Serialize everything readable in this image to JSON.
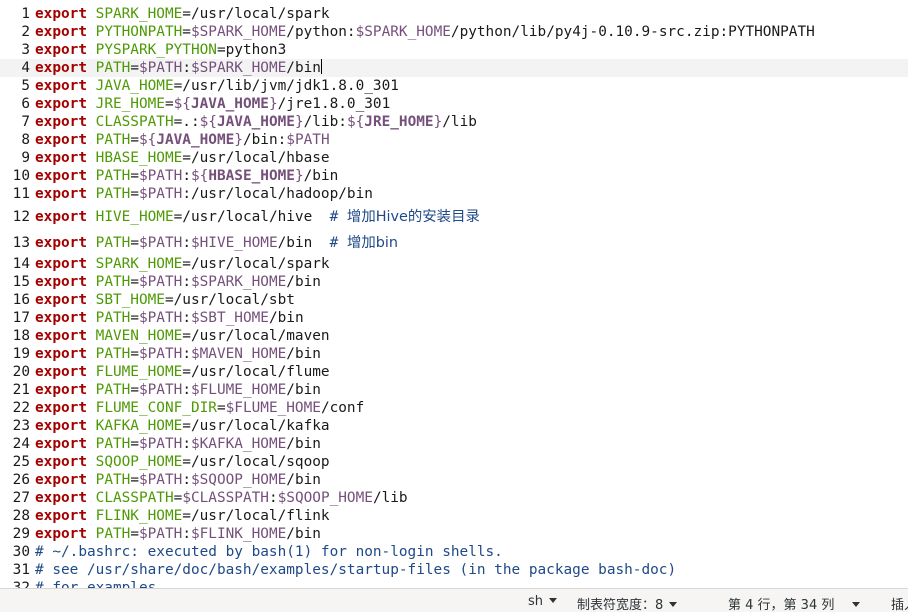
{
  "editor": {
    "lines": [
      {
        "n": "1",
        "segments": [
          {
            "t": "export",
            "c": "kw"
          },
          {
            "t": " "
          },
          {
            "t": "SPARK_HOME",
            "c": "var"
          },
          {
            "t": "=/usr/local/spark"
          }
        ]
      },
      {
        "n": "2",
        "segments": [
          {
            "t": "export",
            "c": "kw"
          },
          {
            "t": " "
          },
          {
            "t": "PYTHONPATH",
            "c": "var"
          },
          {
            "t": "="
          },
          {
            "t": "$SPARK_HOME",
            "c": "sub"
          },
          {
            "t": "/python:"
          },
          {
            "t": "$SPARK_HOME",
            "c": "sub"
          },
          {
            "t": "/python/lib/py4j-0.10.9-src.zip:"
          },
          {
            "t": "PYTHONPATH"
          }
        ]
      },
      {
        "n": "3",
        "segments": [
          {
            "t": "export",
            "c": "kw"
          },
          {
            "t": " "
          },
          {
            "t": "PYSPARK_PYTHON",
            "c": "var"
          },
          {
            "t": "=python3"
          }
        ]
      },
      {
        "n": "4",
        "current": true,
        "segments": [
          {
            "t": "export",
            "c": "kw"
          },
          {
            "t": " "
          },
          {
            "t": "PATH",
            "c": "var"
          },
          {
            "t": "="
          },
          {
            "t": "$PATH",
            "c": "sub"
          },
          {
            "t": ":"
          },
          {
            "t": "$SPARK_HOME",
            "c": "sub"
          },
          {
            "t": "/bin"
          }
        ]
      },
      {
        "n": "5",
        "segments": [
          {
            "t": "export",
            "c": "kw"
          },
          {
            "t": " "
          },
          {
            "t": "JAVA_HOME",
            "c": "var"
          },
          {
            "t": "=/usr/lib/jvm/jdk1.8.0_301"
          }
        ]
      },
      {
        "n": "6",
        "segments": [
          {
            "t": "export",
            "c": "kw"
          },
          {
            "t": " "
          },
          {
            "t": "JRE_HOME",
            "c": "var"
          },
          {
            "t": "="
          },
          {
            "t": "${",
            "c": "sub"
          },
          {
            "t": "JAVA_HOME",
            "c": "sub bold"
          },
          {
            "t": "}",
            "c": "sub"
          },
          {
            "t": "/jre1.8.0_301"
          }
        ]
      },
      {
        "n": "7",
        "segments": [
          {
            "t": "export",
            "c": "kw"
          },
          {
            "t": " "
          },
          {
            "t": "CLASSPATH",
            "c": "var"
          },
          {
            "t": "=.:"
          },
          {
            "t": "${",
            "c": "sub"
          },
          {
            "t": "JAVA_HOME",
            "c": "sub bold"
          },
          {
            "t": "}",
            "c": "sub"
          },
          {
            "t": "/lib:"
          },
          {
            "t": "${",
            "c": "sub"
          },
          {
            "t": "JRE_HOME",
            "c": "sub bold"
          },
          {
            "t": "}",
            "c": "sub"
          },
          {
            "t": "/lib"
          }
        ]
      },
      {
        "n": "8",
        "segments": [
          {
            "t": "export",
            "c": "kw"
          },
          {
            "t": " "
          },
          {
            "t": "PATH",
            "c": "var"
          },
          {
            "t": "="
          },
          {
            "t": "${",
            "c": "sub"
          },
          {
            "t": "JAVA_HOME",
            "c": "sub bold"
          },
          {
            "t": "}",
            "c": "sub"
          },
          {
            "t": "/bin:"
          },
          {
            "t": "$PATH",
            "c": "sub"
          }
        ]
      },
      {
        "n": "9",
        "segments": [
          {
            "t": "export",
            "c": "kw"
          },
          {
            "t": " "
          },
          {
            "t": "HBASE_HOME",
            "c": "var"
          },
          {
            "t": "=/usr/local/hbase"
          }
        ]
      },
      {
        "n": "10",
        "segments": [
          {
            "t": "export",
            "c": "kw"
          },
          {
            "t": " "
          },
          {
            "t": "PATH",
            "c": "var"
          },
          {
            "t": "="
          },
          {
            "t": "$PATH",
            "c": "sub"
          },
          {
            "t": ":"
          },
          {
            "t": "${",
            "c": "sub"
          },
          {
            "t": "HBASE_HOME",
            "c": "sub bold"
          },
          {
            "t": "}",
            "c": "sub"
          },
          {
            "t": "/bin"
          }
        ]
      },
      {
        "n": "11",
        "segments": [
          {
            "t": "export",
            "c": "kw"
          },
          {
            "t": " "
          },
          {
            "t": "PATH",
            "c": "var"
          },
          {
            "t": "="
          },
          {
            "t": "$PATH",
            "c": "sub"
          },
          {
            "t": ":/usr/local/hadoop/bin"
          }
        ]
      },
      {
        "n": "12",
        "segments": [
          {
            "t": "export",
            "c": "kw"
          },
          {
            "t": " "
          },
          {
            "t": "HIVE_HOME",
            "c": "var"
          },
          {
            "t": "=/usr/local/hive  "
          },
          {
            "t": "# ",
            "c": "cmt"
          },
          {
            "t": "增加Hive的安装目录",
            "c": "cmt cjk"
          }
        ]
      },
      {
        "n": "13",
        "segments": [
          {
            "t": "export",
            "c": "kw"
          },
          {
            "t": " "
          },
          {
            "t": "PATH",
            "c": "var"
          },
          {
            "t": "="
          },
          {
            "t": "$PATH",
            "c": "sub"
          },
          {
            "t": ":"
          },
          {
            "t": "$HIVE_HOME",
            "c": "sub"
          },
          {
            "t": "/bin  "
          },
          {
            "t": "# ",
            "c": "cmt"
          },
          {
            "t": "增加bin",
            "c": "cmt cjk"
          }
        ]
      },
      {
        "n": "14",
        "segments": [
          {
            "t": "export",
            "c": "kw"
          },
          {
            "t": " "
          },
          {
            "t": "SPARK_HOME",
            "c": "var"
          },
          {
            "t": "=/usr/local/spark"
          }
        ]
      },
      {
        "n": "15",
        "segments": [
          {
            "t": "export",
            "c": "kw"
          },
          {
            "t": " "
          },
          {
            "t": "PATH",
            "c": "var"
          },
          {
            "t": "="
          },
          {
            "t": "$PATH",
            "c": "sub"
          },
          {
            "t": ":"
          },
          {
            "t": "$SPARK_HOME",
            "c": "sub"
          },
          {
            "t": "/bin"
          }
        ]
      },
      {
        "n": "16",
        "segments": [
          {
            "t": "export",
            "c": "kw"
          },
          {
            "t": " "
          },
          {
            "t": "SBT_HOME",
            "c": "var"
          },
          {
            "t": "=/usr/local/sbt"
          }
        ]
      },
      {
        "n": "17",
        "segments": [
          {
            "t": "export",
            "c": "kw"
          },
          {
            "t": " "
          },
          {
            "t": "PATH",
            "c": "var"
          },
          {
            "t": "="
          },
          {
            "t": "$PATH",
            "c": "sub"
          },
          {
            "t": ":"
          },
          {
            "t": "$SBT_HOME",
            "c": "sub"
          },
          {
            "t": "/bin"
          }
        ]
      },
      {
        "n": "18",
        "segments": [
          {
            "t": "export",
            "c": "kw"
          },
          {
            "t": " "
          },
          {
            "t": "MAVEN_HOME",
            "c": "var"
          },
          {
            "t": "=/usr/local/maven"
          }
        ]
      },
      {
        "n": "19",
        "segments": [
          {
            "t": "export",
            "c": "kw"
          },
          {
            "t": " "
          },
          {
            "t": "PATH",
            "c": "var"
          },
          {
            "t": "="
          },
          {
            "t": "$PATH",
            "c": "sub"
          },
          {
            "t": ":"
          },
          {
            "t": "$MAVEN_HOME",
            "c": "sub"
          },
          {
            "t": "/bin"
          }
        ]
      },
      {
        "n": "20",
        "segments": [
          {
            "t": "export",
            "c": "kw"
          },
          {
            "t": " "
          },
          {
            "t": "FLUME_HOME",
            "c": "var"
          },
          {
            "t": "=/usr/local/flume"
          }
        ]
      },
      {
        "n": "21",
        "segments": [
          {
            "t": "export",
            "c": "kw"
          },
          {
            "t": " "
          },
          {
            "t": "PATH",
            "c": "var"
          },
          {
            "t": "="
          },
          {
            "t": "$PATH",
            "c": "sub"
          },
          {
            "t": ":"
          },
          {
            "t": "$FLUME_HOME",
            "c": "sub"
          },
          {
            "t": "/bin"
          }
        ]
      },
      {
        "n": "22",
        "segments": [
          {
            "t": "export",
            "c": "kw"
          },
          {
            "t": " "
          },
          {
            "t": "FLUME_CONF_DIR",
            "c": "var"
          },
          {
            "t": "="
          },
          {
            "t": "$FLUME_HOME",
            "c": "sub"
          },
          {
            "t": "/conf"
          }
        ]
      },
      {
        "n": "23",
        "segments": [
          {
            "t": "export",
            "c": "kw"
          },
          {
            "t": " "
          },
          {
            "t": "KAFKA_HOME",
            "c": "var"
          },
          {
            "t": "=/usr/local/kafka"
          }
        ]
      },
      {
        "n": "24",
        "segments": [
          {
            "t": "export",
            "c": "kw"
          },
          {
            "t": " "
          },
          {
            "t": "PATH",
            "c": "var"
          },
          {
            "t": "="
          },
          {
            "t": "$PATH",
            "c": "sub"
          },
          {
            "t": ":"
          },
          {
            "t": "$KAFKA_HOME",
            "c": "sub"
          },
          {
            "t": "/bin"
          }
        ]
      },
      {
        "n": "25",
        "segments": [
          {
            "t": "export",
            "c": "kw"
          },
          {
            "t": " "
          },
          {
            "t": "SQOOP_HOME",
            "c": "var"
          },
          {
            "t": "=/usr/local/sqoop"
          }
        ]
      },
      {
        "n": "26",
        "segments": [
          {
            "t": "export",
            "c": "kw"
          },
          {
            "t": " "
          },
          {
            "t": "PATH",
            "c": "var"
          },
          {
            "t": "="
          },
          {
            "t": "$PATH",
            "c": "sub"
          },
          {
            "t": ":"
          },
          {
            "t": "$SQOOP_HOME",
            "c": "sub"
          },
          {
            "t": "/bin"
          }
        ]
      },
      {
        "n": "27",
        "segments": [
          {
            "t": "export",
            "c": "kw"
          },
          {
            "t": " "
          },
          {
            "t": "CLASSPATH",
            "c": "var"
          },
          {
            "t": "="
          },
          {
            "t": "$CLASSPATH",
            "c": "sub"
          },
          {
            "t": ":"
          },
          {
            "t": "$SQOOP_HOME",
            "c": "sub"
          },
          {
            "t": "/lib"
          }
        ]
      },
      {
        "n": "28",
        "segments": [
          {
            "t": "export",
            "c": "kw"
          },
          {
            "t": " "
          },
          {
            "t": "FLINK_HOME",
            "c": "var"
          },
          {
            "t": "=/usr/local/flink"
          }
        ]
      },
      {
        "n": "29",
        "segments": [
          {
            "t": "export",
            "c": "kw"
          },
          {
            "t": " "
          },
          {
            "t": "PATH",
            "c": "var"
          },
          {
            "t": "="
          },
          {
            "t": "$PATH",
            "c": "sub"
          },
          {
            "t": ":"
          },
          {
            "t": "$FLINK_HOME",
            "c": "sub"
          },
          {
            "t": "/bin"
          }
        ]
      },
      {
        "n": "30",
        "segments": [
          {
            "t": "# ~/.bashrc: executed by bash(1) for non-login shells.",
            "c": "cmt"
          }
        ]
      },
      {
        "n": "31",
        "segments": [
          {
            "t": "# see /usr/share/doc/bash/examples/startup-files (in the package bash-doc)",
            "c": "cmt"
          }
        ]
      },
      {
        "n": "32",
        "segments": [
          {
            "t": "# for examples",
            "c": "cmt"
          }
        ]
      }
    ]
  },
  "statusbar": {
    "language": "sh",
    "tab_width_label": "制表符宽度：8",
    "cursor_position": "第 4 行，第 34 列",
    "insert_mode": "插入"
  },
  "colors": {
    "keyword": "#a40000",
    "variable": "#4e9a06",
    "substitution": "#75507b",
    "comment": "#204a87",
    "current_line": "#f3f3f3",
    "statusbar_bg": "#f6f5f4"
  }
}
